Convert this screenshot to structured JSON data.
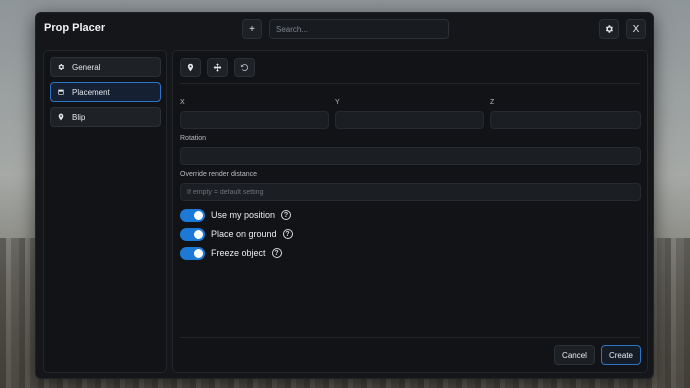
{
  "window": {
    "title": "Prop Placer",
    "add_label": "+",
    "search_placeholder": "Search...",
    "close_label": "X"
  },
  "sidebar": {
    "items": [
      {
        "label": "General",
        "icon": "gear-icon"
      },
      {
        "label": "Placement",
        "icon": "calendar-icon",
        "active": true
      },
      {
        "label": "Blip",
        "icon": "map-pin-icon"
      }
    ]
  },
  "toolbar": {
    "icons": [
      "map-pin-icon",
      "move-icon",
      "undo-icon"
    ]
  },
  "form": {
    "x_label": "X",
    "y_label": "Y",
    "z_label": "Z",
    "x_value": "",
    "y_value": "",
    "z_value": "",
    "rotation_label": "Rotation",
    "rotation_value": "",
    "render_distance_label": "Override render distance",
    "render_distance_placeholder": "If empty = default setting",
    "toggles": [
      {
        "label": "Use my position",
        "on": true
      },
      {
        "label": "Place on ground",
        "on": true
      },
      {
        "label": "Freeze object",
        "on": true
      }
    ]
  },
  "footer": {
    "cancel_label": "Cancel",
    "create_label": "Create"
  },
  "colors": {
    "accent": "#1c7ad6",
    "active_border": "#2d74c8",
    "panel_bg": "#141619"
  }
}
